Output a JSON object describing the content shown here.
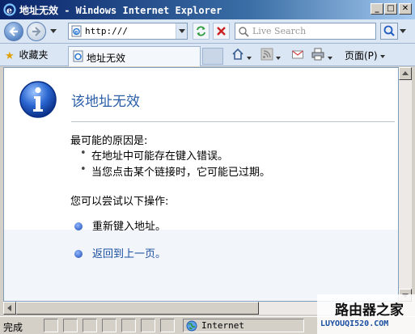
{
  "window": {
    "title": "地址无效 - Windows Internet Explorer",
    "min_label": "_",
    "max_label": "□",
    "close_label": "✕"
  },
  "address_bar": {
    "value": "http:///",
    "refresh_icon": "refresh-icon",
    "stop_icon": "stop-icon"
  },
  "search": {
    "placeholder": "Live Search"
  },
  "favorites": {
    "label": "收藏夹"
  },
  "tab": {
    "title": "地址无效"
  },
  "command_bar": {
    "page_label": "页面(P)"
  },
  "content": {
    "title": "该地址无效",
    "causes_heading": "最可能的原因是:",
    "causes": [
      "在地址中可能存在键入错误。",
      "当您点击某个链接时，它可能已过期。"
    ],
    "try_heading": "您可以尝试以下操作:",
    "actions": [
      "重新键入地址。",
      "返回到上一页。"
    ]
  },
  "status": {
    "text": "完成",
    "zone": "Internet"
  },
  "watermark": {
    "top": "路由器之家",
    "bottom": "LUYOUQI520.COM"
  },
  "colors": {
    "title_gradient_start": "#0a246a",
    "link": "#1a4ea0",
    "error_title": "#2a5ea8"
  }
}
